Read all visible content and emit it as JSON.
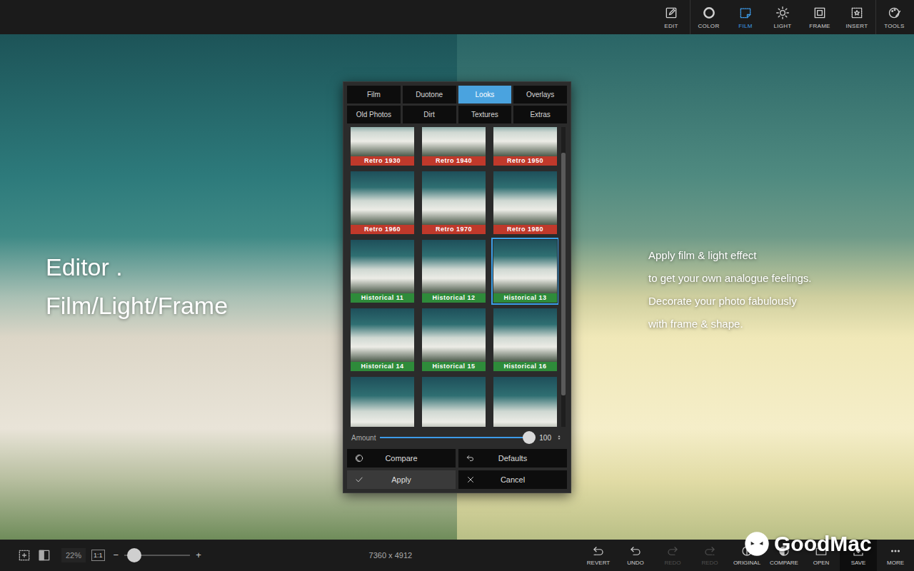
{
  "toolbar": {
    "items": [
      {
        "label": "EDIT",
        "selected": false
      },
      {
        "label": "COLOR",
        "selected": false
      },
      {
        "label": "FILM",
        "selected": true
      },
      {
        "label": "LIGHT",
        "selected": false
      },
      {
        "label": "FRAME",
        "selected": false
      },
      {
        "label": "INSERT",
        "selected": false
      },
      {
        "label": "TOOLS",
        "selected": false
      }
    ]
  },
  "promo": {
    "title_lines": [
      "Editor .",
      "Film/Light/Frame"
    ],
    "caption_lines": [
      "Apply film & light effect",
      "to get your own analogue feelings.",
      "Decorate your photo fabulously",
      "with frame & shape."
    ]
  },
  "dialog": {
    "tabs": [
      {
        "label": "Film",
        "selected": false
      },
      {
        "label": "Duotone",
        "selected": false
      },
      {
        "label": "Looks",
        "selected": true
      },
      {
        "label": "Overlays",
        "selected": false
      },
      {
        "label": "Old Photos",
        "selected": false
      },
      {
        "label": "Dirt",
        "selected": false
      },
      {
        "label": "Textures",
        "selected": false
      },
      {
        "label": "Extras",
        "selected": false
      }
    ],
    "thumbnails": [
      {
        "label": "Retro 1930",
        "selected": false,
        "color": "#c0392b"
      },
      {
        "label": "Retro 1940",
        "selected": false,
        "color": "#c0392b"
      },
      {
        "label": "Retro 1950",
        "selected": false,
        "color": "#c0392b"
      },
      {
        "label": "Retro 1960",
        "selected": false,
        "color": "#c0392b"
      },
      {
        "label": "Retro 1970",
        "selected": false,
        "color": "#c0392b"
      },
      {
        "label": "Retro 1980",
        "selected": false,
        "color": "#c0392b"
      },
      {
        "label": "Historical 11",
        "selected": false,
        "color": "#2e8b3a"
      },
      {
        "label": "Historical 12",
        "selected": false,
        "color": "#2e8b3a"
      },
      {
        "label": "Historical 13",
        "selected": true,
        "color": "#2e8b3a"
      },
      {
        "label": "Historical 14",
        "selected": false,
        "color": "#2e8b3a"
      },
      {
        "label": "Historical 15",
        "selected": false,
        "color": "#2e8b3a"
      },
      {
        "label": "Historical 16",
        "selected": false,
        "color": "#2e8b3a"
      },
      {
        "label": "",
        "selected": false,
        "color": "#2e8b3a"
      },
      {
        "label": "",
        "selected": false,
        "color": "#2e8b3a"
      },
      {
        "label": "",
        "selected": false,
        "color": "#2e8b3a"
      }
    ],
    "scroll_level": 0.45,
    "amount": {
      "label": "Amount",
      "value": "100",
      "level": 1.0
    },
    "buttons": [
      "Compare",
      "Defaults",
      "Apply",
      "Cancel"
    ]
  },
  "status_bar": {
    "zoom": "22%",
    "fit": "1:1",
    "zoom_out": "−",
    "zoom_in": "+",
    "zoom_level": 0.15,
    "dimensions": "7360 x 4912",
    "actions": [
      {
        "label": "REVERT",
        "disabled": false
      },
      {
        "label": "UNDO",
        "disabled": false
      },
      {
        "label": "REDO",
        "disabled": true
      },
      {
        "label": "REDO",
        "disabled": true
      },
      {
        "label": "ORIGINAL",
        "disabled": false
      },
      {
        "label": "COMPARE",
        "disabled": false
      },
      {
        "label": "OPEN",
        "disabled": false
      },
      {
        "label": "SAVE",
        "disabled": false
      },
      {
        "label": "MORE",
        "disabled": false
      }
    ]
  },
  "watermark": "GoodMac"
}
